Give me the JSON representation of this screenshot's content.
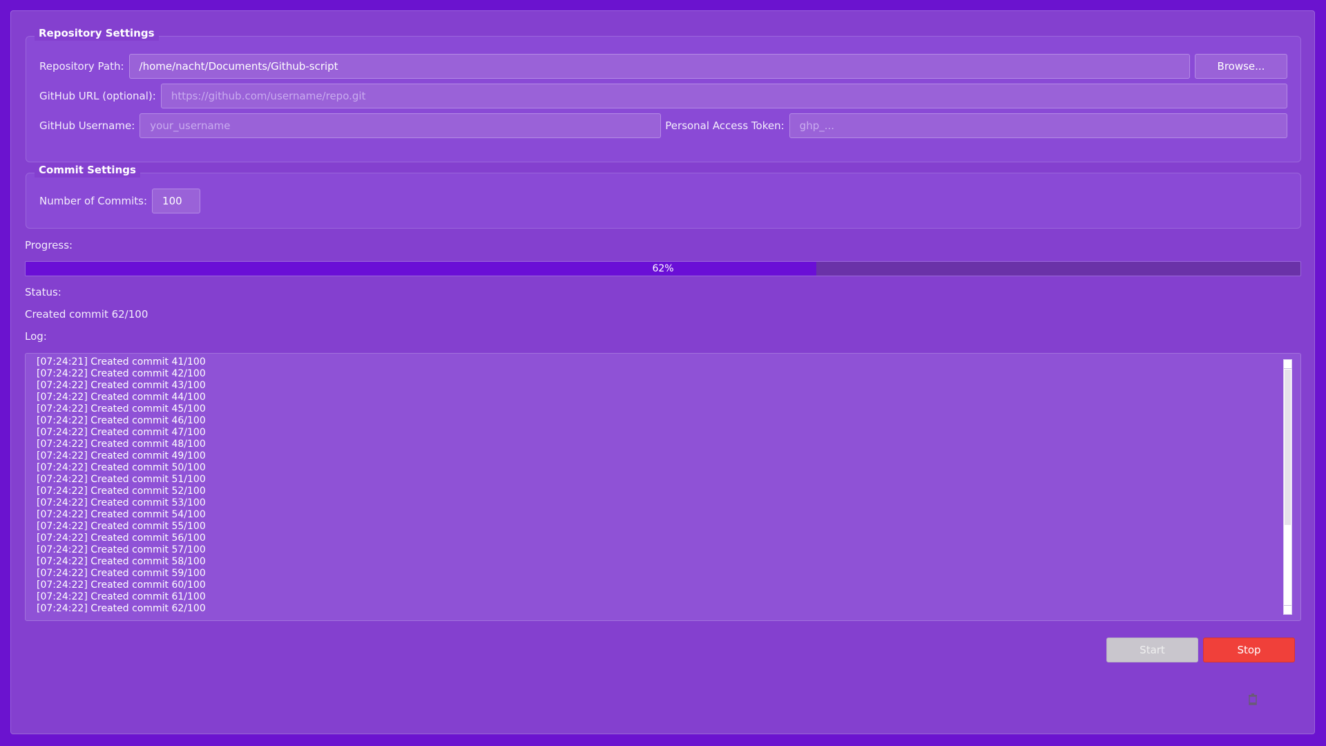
{
  "repository_settings": {
    "title": "Repository Settings",
    "path_label": "Repository Path:",
    "path_value": "/home/nacht/Documents/Github-script",
    "browse_label": "Browse...",
    "url_label": "GitHub URL (optional):",
    "url_placeholder": "https://github.com/username/repo.git",
    "username_label": "GitHub Username:",
    "username_placeholder": "your_username",
    "token_label": "Personal Access Token:",
    "token_placeholder": "ghp_..."
  },
  "commit_settings": {
    "title": "Commit Settings",
    "count_label": "Number of Commits:",
    "count_value": "100"
  },
  "progress": {
    "label": "Progress:",
    "percent": 62,
    "text": "62%"
  },
  "status": {
    "label": "Status:",
    "text": "Created commit 62/100"
  },
  "log": {
    "label": "Log:",
    "lines": [
      "[07:24:21] Created commit 41/100",
      "[07:24:22] Created commit 42/100",
      "[07:24:22] Created commit 43/100",
      "[07:24:22] Created commit 44/100",
      "[07:24:22] Created commit 45/100",
      "[07:24:22] Created commit 46/100",
      "[07:24:22] Created commit 47/100",
      "[07:24:22] Created commit 48/100",
      "[07:24:22] Created commit 49/100",
      "[07:24:22] Created commit 50/100",
      "[07:24:22] Created commit 51/100",
      "[07:24:22] Created commit 52/100",
      "[07:24:22] Created commit 53/100",
      "[07:24:22] Created commit 54/100",
      "[07:24:22] Created commit 55/100",
      "[07:24:22] Created commit 56/100",
      "[07:24:22] Created commit 57/100",
      "[07:24:22] Created commit 58/100",
      "[07:24:22] Created commit 59/100",
      "[07:24:22] Created commit 60/100",
      "[07:24:22] Created commit 61/100",
      "[07:24:22] Created commit 62/100"
    ]
  },
  "actions": {
    "start_label": "Start",
    "stop_label": "Stop"
  },
  "icons": {
    "corner": "trash-icon"
  },
  "colors": {
    "background": "#6b13cf",
    "panel": "#8440cf",
    "progress_fill": "#6a0fd6",
    "stop": "#f0403a",
    "start_disabled": "#c9c6cd"
  }
}
